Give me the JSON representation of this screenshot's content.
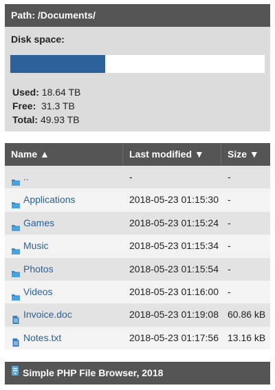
{
  "header": {
    "path_label": "Path: /Documents/"
  },
  "disk": {
    "title": "Disk space:",
    "used_fraction": 0.373,
    "used_label": "Used:",
    "used_value": "18.64 TB",
    "free_label": "Free:",
    "free_value": "31.3 TB",
    "total_label": "Total:",
    "total_value": "49.93 TB",
    "bar_color": "#2b6198"
  },
  "table": {
    "columns": {
      "name": "Name ▲",
      "modified": "Last modified ▼",
      "size": "Size ▼"
    },
    "rows": [
      {
        "name": "..",
        "icon": "folder-icon",
        "modified": "-",
        "size": "-"
      },
      {
        "name": "Applications",
        "icon": "folder-icon",
        "modified": "2018-05-23 01:15:30",
        "size": "-"
      },
      {
        "name": "Games",
        "icon": "folder-icon",
        "modified": "2018-05-23 01:15:24",
        "size": "-"
      },
      {
        "name": "Music",
        "icon": "folder-icon",
        "modified": "2018-05-23 01:15:34",
        "size": "-"
      },
      {
        "name": "Photos",
        "icon": "folder-icon",
        "modified": "2018-05-23 01:15:54",
        "size": "-"
      },
      {
        "name": "Videos",
        "icon": "folder-icon",
        "modified": "2018-05-23 01:16:00",
        "size": "-"
      },
      {
        "name": "Invoice.doc",
        "icon": "document-icon",
        "modified": "2018-05-23 01:19:08",
        "size": "60.86 kB"
      },
      {
        "name": "Notes.txt",
        "icon": "document-icon",
        "modified": "2018-05-23 01:17:56",
        "size": "13.16 kB"
      }
    ]
  },
  "footer": {
    "text": "Simple PHP File Browser, 2018",
    "icon": "server-icon"
  }
}
